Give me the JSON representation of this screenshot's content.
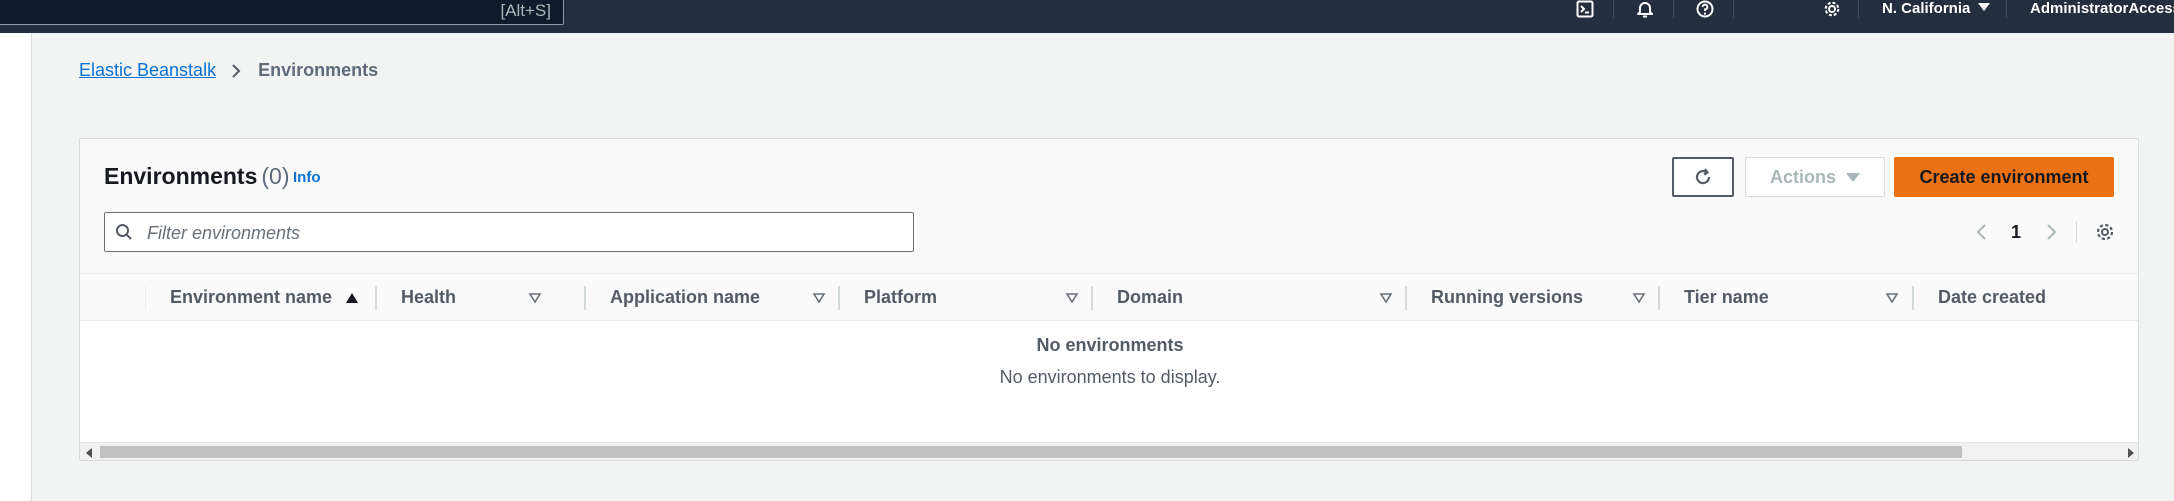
{
  "topnav": {
    "search_shortcut": "[Alt+S]",
    "icons": [
      "cloudshell-icon",
      "bell-icon",
      "help-icon",
      "settings-icon"
    ],
    "region": "N. California",
    "account": "AdministratorAccess/"
  },
  "breadcrumb": {
    "root": "Elastic Beanstalk",
    "current": "Environments"
  },
  "panel": {
    "title": "Environments",
    "count": "(0)",
    "info": "Info",
    "actions_label": "Actions",
    "create_label": "Create environment",
    "filter_placeholder": "Filter environments",
    "page": "1"
  },
  "table": {
    "columns": [
      {
        "label": "Environment name",
        "sort": "ascending"
      },
      {
        "label": "Health",
        "sort": "none"
      },
      {
        "label": "Application name",
        "sort": "none"
      },
      {
        "label": "Platform",
        "sort": "none"
      },
      {
        "label": "Domain",
        "sort": "none"
      },
      {
        "label": "Running versions",
        "sort": "none"
      },
      {
        "label": "Tier name",
        "sort": "none"
      },
      {
        "label": "Date created",
        "sort": "none"
      }
    ],
    "empty_title": "No environments",
    "empty_description": "No environments to display."
  },
  "colors": {
    "nav_bg": "#232f3e",
    "primary_button": "#ec7211",
    "link": "#0972d3",
    "page_bg": "#f2f3f3"
  }
}
